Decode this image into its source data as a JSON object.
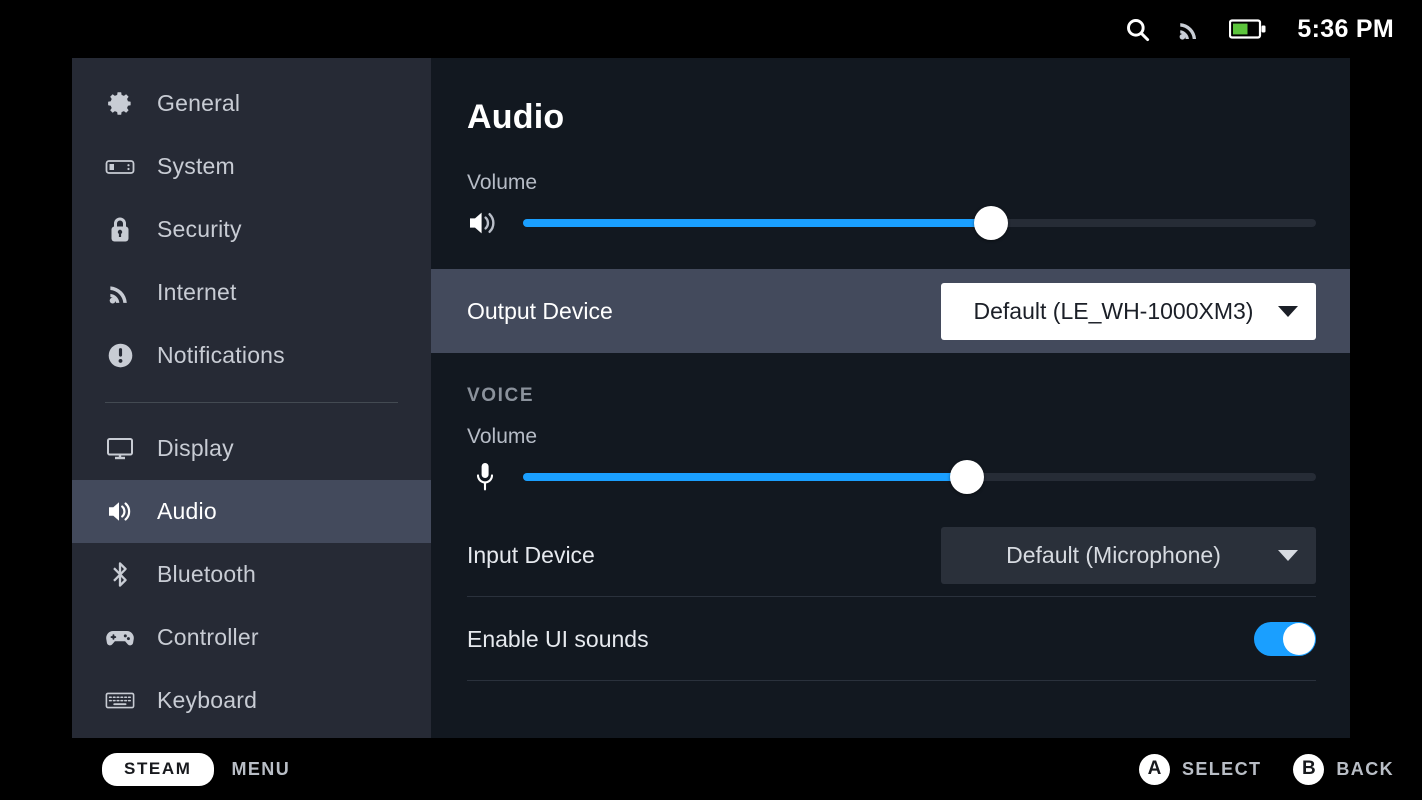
{
  "statusbar": {
    "search_icon": "search-icon",
    "wifi_icon": "wifi-icon",
    "battery_icon": "battery-icon",
    "time": "5:36 PM"
  },
  "sidebar": {
    "items": [
      {
        "label": "General",
        "icon": "gear-icon",
        "selected": false
      },
      {
        "label": "System",
        "icon": "steamdeck-icon",
        "selected": false
      },
      {
        "label": "Security",
        "icon": "lock-icon",
        "selected": false
      },
      {
        "label": "Internet",
        "icon": "wifi-icon",
        "selected": false
      },
      {
        "label": "Notifications",
        "icon": "alert-circle-icon",
        "selected": false
      },
      {
        "label": "Display",
        "icon": "monitor-icon",
        "selected": false
      },
      {
        "label": "Audio",
        "icon": "speaker-icon",
        "selected": true
      },
      {
        "label": "Bluetooth",
        "icon": "bluetooth-icon",
        "selected": false
      },
      {
        "label": "Controller",
        "icon": "gamepad-icon",
        "selected": false
      },
      {
        "label": "Keyboard",
        "icon": "keyboard-icon",
        "selected": false
      }
    ]
  },
  "main": {
    "title": "Audio",
    "volume": {
      "label": "Volume",
      "icon": "speaker-icon",
      "percent": 59
    },
    "output_device": {
      "label": "Output Device",
      "value": "Default (LE_WH-1000XM3)",
      "caret_icon": "chevron-down-icon",
      "focused": true
    },
    "voice": {
      "header": "VOICE",
      "volume": {
        "label": "Volume",
        "icon": "microphone-icon",
        "percent": 56
      },
      "input_device": {
        "label": "Input Device",
        "value": "Default (Microphone)",
        "caret_icon": "chevron-down-icon",
        "focused": false
      },
      "ui_sounds": {
        "label": "Enable UI sounds",
        "enabled": true
      }
    }
  },
  "bottombar": {
    "steam_label": "STEAM",
    "menu_label": "MENU",
    "select_glyph": "A",
    "select_label": "SELECT",
    "back_glyph": "B",
    "back_label": "BACK"
  },
  "colors": {
    "accent_blue": "#1a9fff",
    "battery_green": "#5cc43c",
    "sidebar_bg": "#262a35",
    "sidebar_selected": "#434a5c",
    "content_bg": "#121820"
  }
}
